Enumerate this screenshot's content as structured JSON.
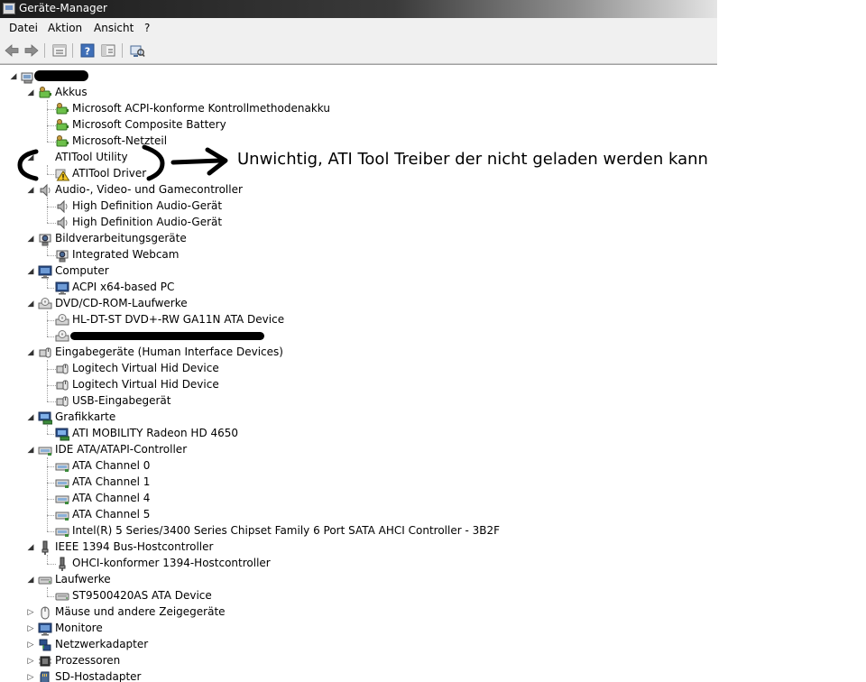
{
  "window": {
    "title": "Geräte-Manager"
  },
  "menu": [
    "Datei",
    "Aktion",
    "Ansicht",
    "?"
  ],
  "toolbar": [
    "back-icon",
    "forward-icon",
    "properties-icon",
    "help-icon",
    "console-icon",
    "scan-hardware-icon"
  ],
  "annotation": "Unwichtig, ATI Tool Treiber der nicht geladen werden kann",
  "tree": {
    "root": {
      "label": "",
      "icon": "computer-root-icon",
      "expanded": true
    },
    "categories": [
      {
        "label": "Akkus",
        "icon": "battery-icon",
        "expanded": true,
        "children": [
          {
            "label": "Microsoft ACPI-konforme Kontrollmethodenakku",
            "icon": "battery-icon"
          },
          {
            "label": "Microsoft Composite Battery",
            "icon": "battery-icon"
          },
          {
            "label": "Microsoft-Netzteil",
            "icon": "battery-icon"
          }
        ]
      },
      {
        "label": "ATITool Utility",
        "icon": "",
        "expanded": true,
        "children": [
          {
            "label": "ATITool Driver",
            "icon": "warning-icon"
          }
        ]
      },
      {
        "label": "Audio-, Video- und Gamecontroller",
        "icon": "speaker-icon",
        "expanded": true,
        "children": [
          {
            "label": "High Definition Audio-Gerät",
            "icon": "speaker-icon"
          },
          {
            "label": "High Definition Audio-Gerät",
            "icon": "speaker-icon"
          }
        ]
      },
      {
        "label": "Bildverarbeitungsgeräte",
        "icon": "camera-icon",
        "expanded": true,
        "children": [
          {
            "label": "Integrated Webcam",
            "icon": "camera-icon"
          }
        ]
      },
      {
        "label": "Computer",
        "icon": "monitor-icon",
        "expanded": true,
        "children": [
          {
            "label": "ACPI x64-based PC",
            "icon": "monitor-icon"
          }
        ]
      },
      {
        "label": "DVD/CD-ROM-Laufwerke",
        "icon": "disc-drive-icon",
        "expanded": true,
        "children": [
          {
            "label": "HL-DT-ST DVD+-RW GA11N ATA Device",
            "icon": "disc-drive-icon"
          },
          {
            "label": "",
            "icon": "disc-drive-icon",
            "redacted": true
          }
        ]
      },
      {
        "label": "Eingabegeräte (Human Interface Devices)",
        "icon": "hid-icon",
        "expanded": true,
        "children": [
          {
            "label": "Logitech Virtual Hid Device",
            "icon": "hid-icon"
          },
          {
            "label": "Logitech Virtual Hid Device",
            "icon": "hid-icon"
          },
          {
            "label": "USB-Eingabegerät",
            "icon": "hid-icon"
          }
        ]
      },
      {
        "label": "Grafikkarte",
        "icon": "display-adapter-icon",
        "expanded": true,
        "children": [
          {
            "label": "ATI MOBILITY Radeon HD 4650",
            "icon": "display-adapter-icon"
          }
        ]
      },
      {
        "label": "IDE ATA/ATAPI-Controller",
        "icon": "ide-controller-icon",
        "expanded": true,
        "children": [
          {
            "label": "ATA Channel 0",
            "icon": "ide-controller-icon"
          },
          {
            "label": "ATA Channel 1",
            "icon": "ide-controller-icon"
          },
          {
            "label": "ATA Channel 4",
            "icon": "ide-controller-icon"
          },
          {
            "label": "ATA Channel 5",
            "icon": "ide-controller-icon"
          },
          {
            "label": "Intel(R) 5 Series/3400 Series Chipset Family 6 Port SATA AHCI Controller - 3B2F",
            "icon": "ide-controller-icon"
          }
        ]
      },
      {
        "label": "IEEE 1394 Bus-Hostcontroller",
        "icon": "firewire-icon",
        "expanded": true,
        "children": [
          {
            "label": "OHCI-konformer 1394-Hostcontroller",
            "icon": "firewire-icon"
          }
        ]
      },
      {
        "label": "Laufwerke",
        "icon": "disk-drive-icon",
        "expanded": true,
        "children": [
          {
            "label": "ST9500420AS ATA Device",
            "icon": "disk-drive-icon"
          }
        ]
      },
      {
        "label": "Mäuse und andere Zeigegeräte",
        "icon": "mouse-icon",
        "expanded": false,
        "children": []
      },
      {
        "label": "Monitore",
        "icon": "monitor-icon",
        "expanded": false,
        "children": []
      },
      {
        "label": "Netzwerkadapter",
        "icon": "network-adapter-icon",
        "expanded": false,
        "children": []
      },
      {
        "label": "Prozessoren",
        "icon": "processor-icon",
        "expanded": false,
        "children": []
      },
      {
        "label": "SD-Hostadapter",
        "icon": "sd-host-icon",
        "expanded": false,
        "children": []
      }
    ]
  }
}
